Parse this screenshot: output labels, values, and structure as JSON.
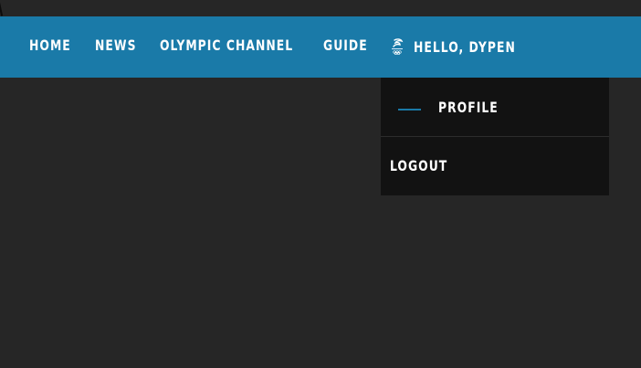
{
  "nav": {
    "items": [
      {
        "label": "HOME"
      },
      {
        "label": "NEWS"
      },
      {
        "label": "OLYMPIC CHANNEL"
      },
      {
        "label": "GUIDE"
      }
    ],
    "user_greeting": "HELLO, DYPEN",
    "user_logo_icon": "olympic-emblem-icon"
  },
  "dropdown": {
    "items": [
      {
        "label": "PROFILE",
        "active": true
      },
      {
        "label": "LOGOUT",
        "active": false
      }
    ]
  },
  "colors": {
    "page_background": "#262626",
    "navbar": "#1a7aa8",
    "dropdown_background": "#121212",
    "text": "#ffffff",
    "accent": "#1a7aa8"
  }
}
